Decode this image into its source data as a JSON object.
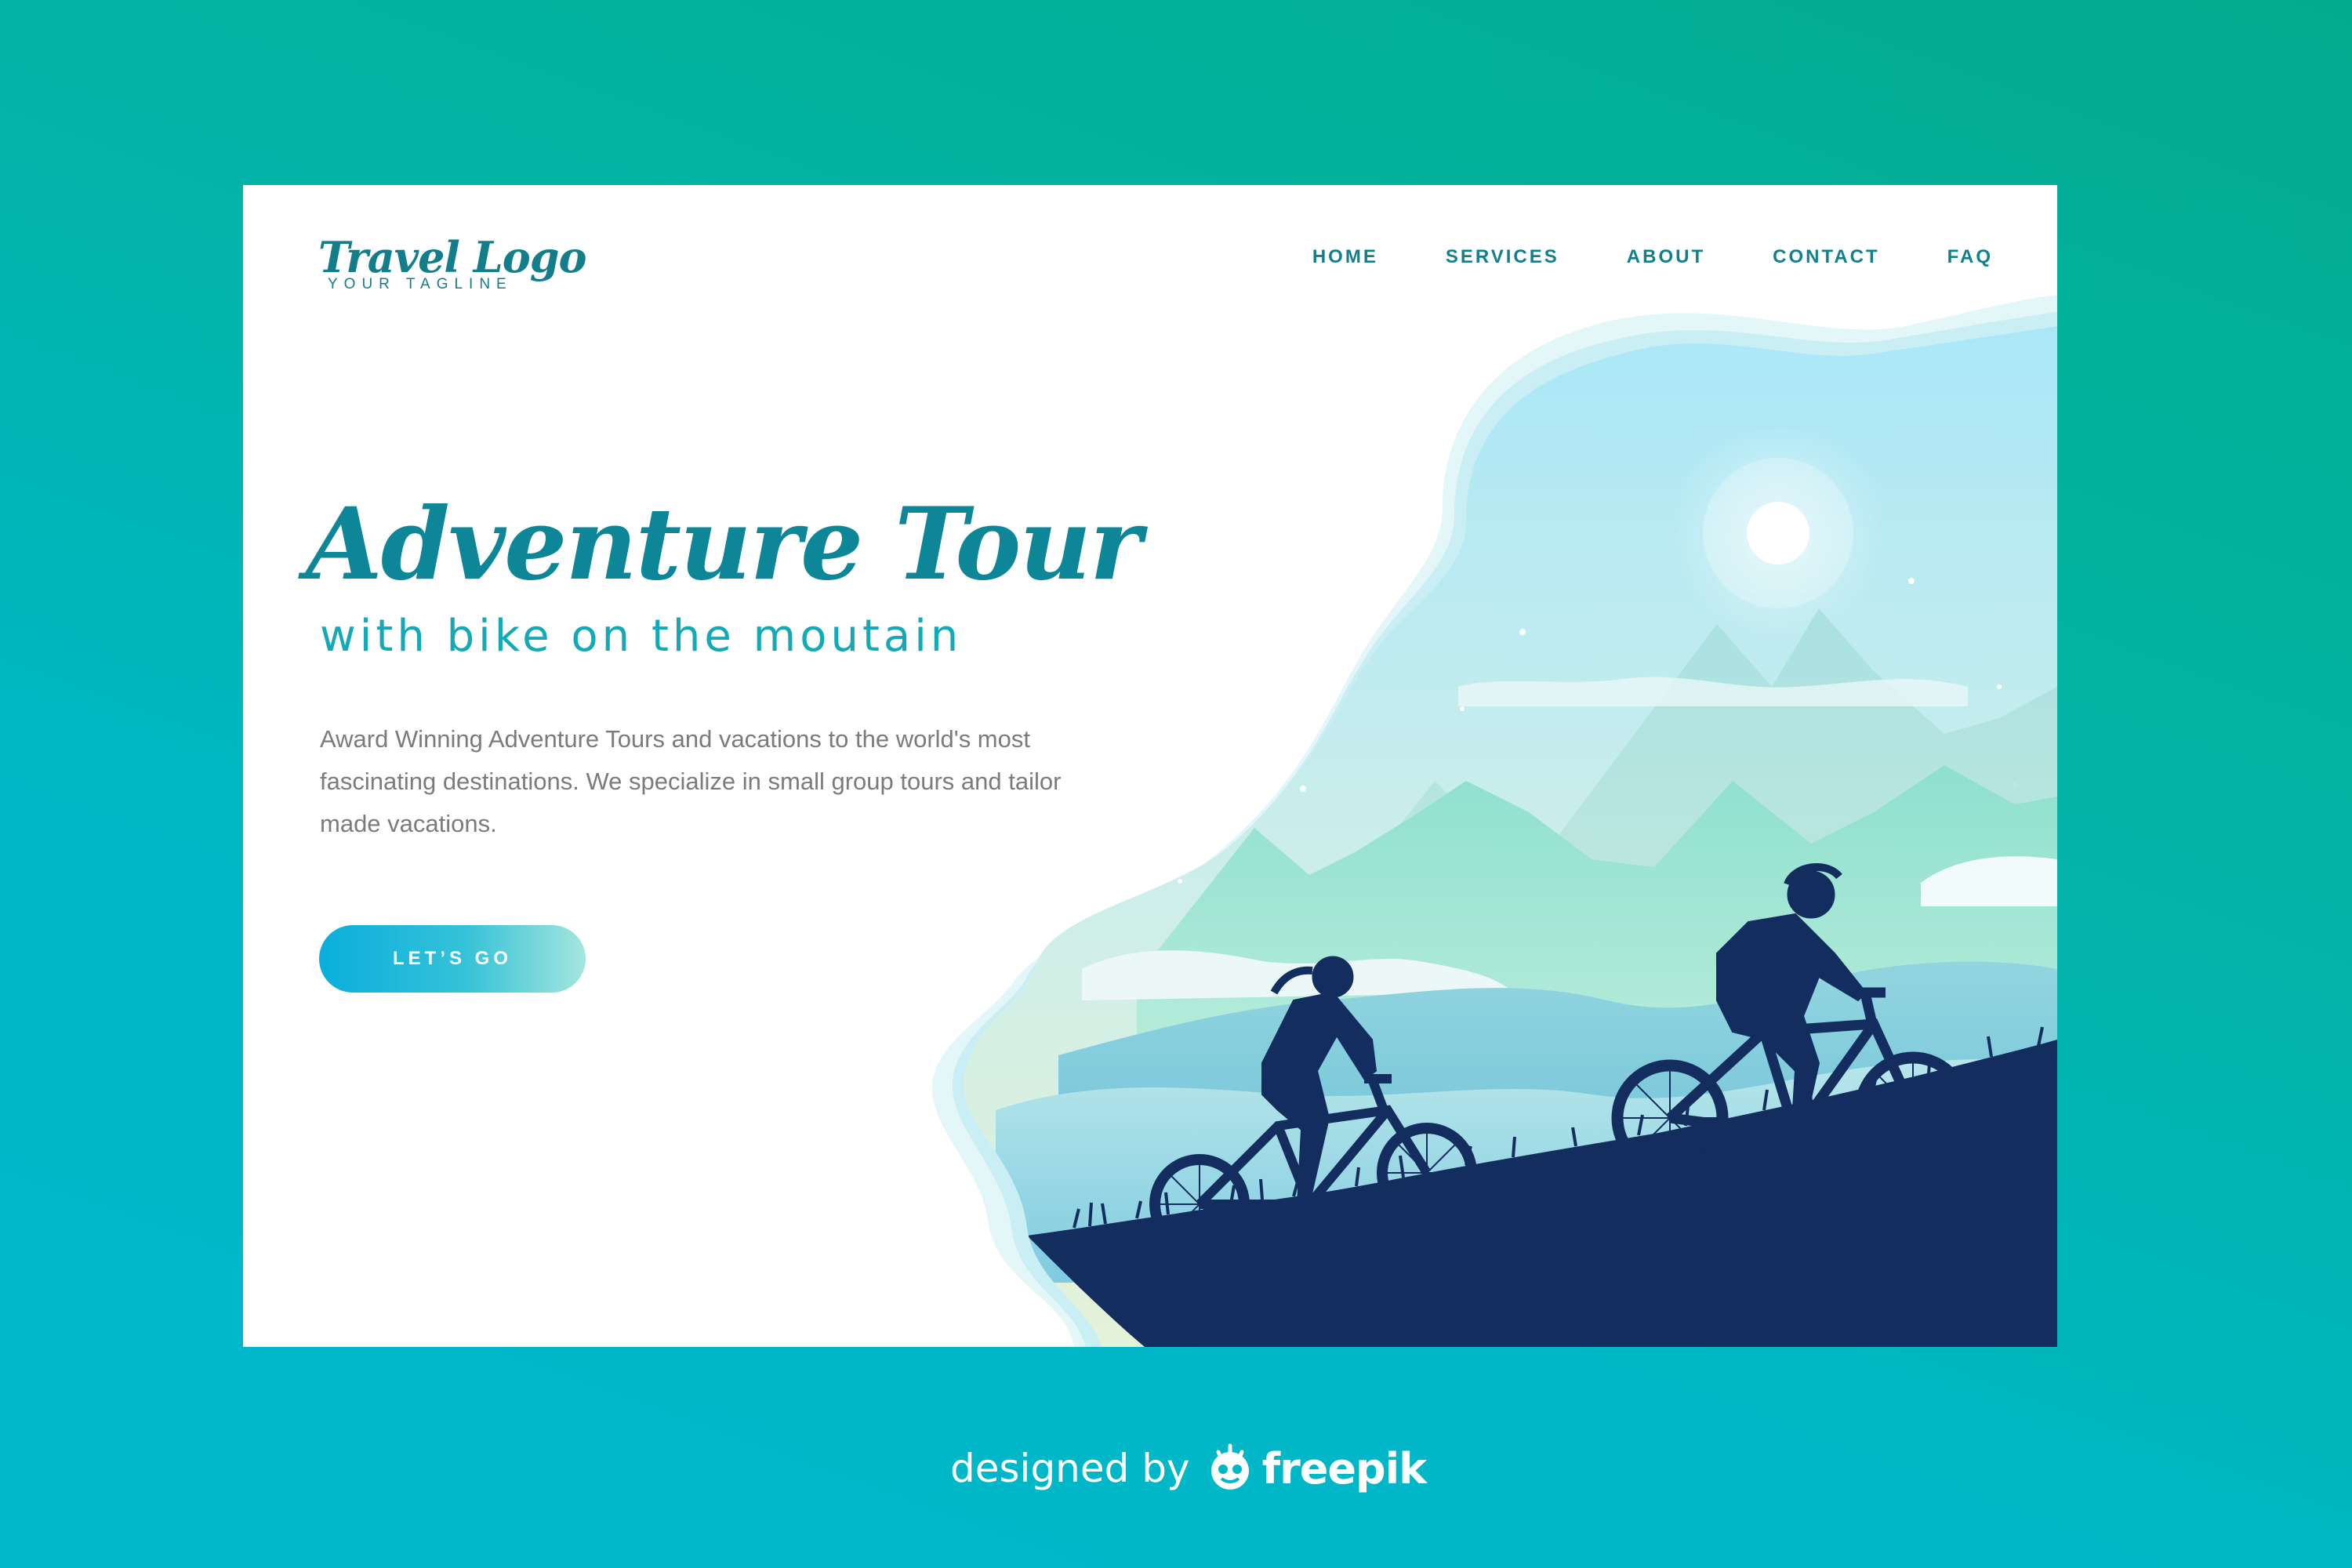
{
  "logo": {
    "name": "Travel Logo",
    "tagline": "YOUR TAGLINE"
  },
  "nav": {
    "items": [
      "HOME",
      "SERVICES",
      "ABOUT",
      "CONTACT",
      "FAQ"
    ]
  },
  "hero": {
    "title": "Adventure Tour",
    "subtitle": "with bike on the moutain",
    "description": "Award Winning Adventure Tours and vacations to the world's most fascinating destinations. We specialize in small group tours and tailor made vacations.",
    "cta_label": "LET’S GO"
  },
  "credit": {
    "prefix": "designed by",
    "brand": "freepik"
  },
  "colors": {
    "brand_teal": "#137d8a",
    "cta_start": "#0aaedc",
    "cta_end": "#a5e6dd",
    "silhouette": "#122d5e",
    "background_start": "#03ab8e",
    "background_end": "#00b9cc"
  },
  "icons": {
    "credit": "freepik-mascot-icon"
  }
}
